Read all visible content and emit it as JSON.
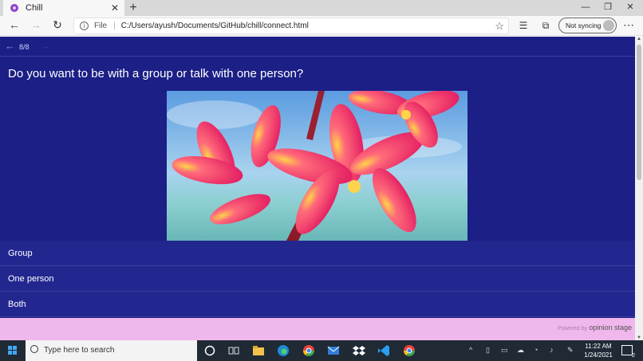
{
  "browser": {
    "tab_title": "Chill",
    "tab_close": "✕",
    "new_tab": "+",
    "address": {
      "scheme": "File",
      "url": "C:/Users/ayush/Documents/GitHub/chill/connect.html"
    },
    "sync_label": "Not syncing"
  },
  "survey": {
    "progress": "8/8",
    "question": "Do you want to be with a group or talk with one person?",
    "options": [
      "Group",
      "One person",
      "Both"
    ],
    "powered_by": "Powered by",
    "brand": "opinion stage"
  },
  "taskbar": {
    "search_placeholder": "Type here to search",
    "time": "11:22 AM",
    "date": "1/24/2021",
    "notification_count": "2"
  },
  "colors": {
    "survey_bg": "#1b1f86",
    "answer_bg": "#22278f",
    "footer_bg": "#f0b7ec"
  }
}
